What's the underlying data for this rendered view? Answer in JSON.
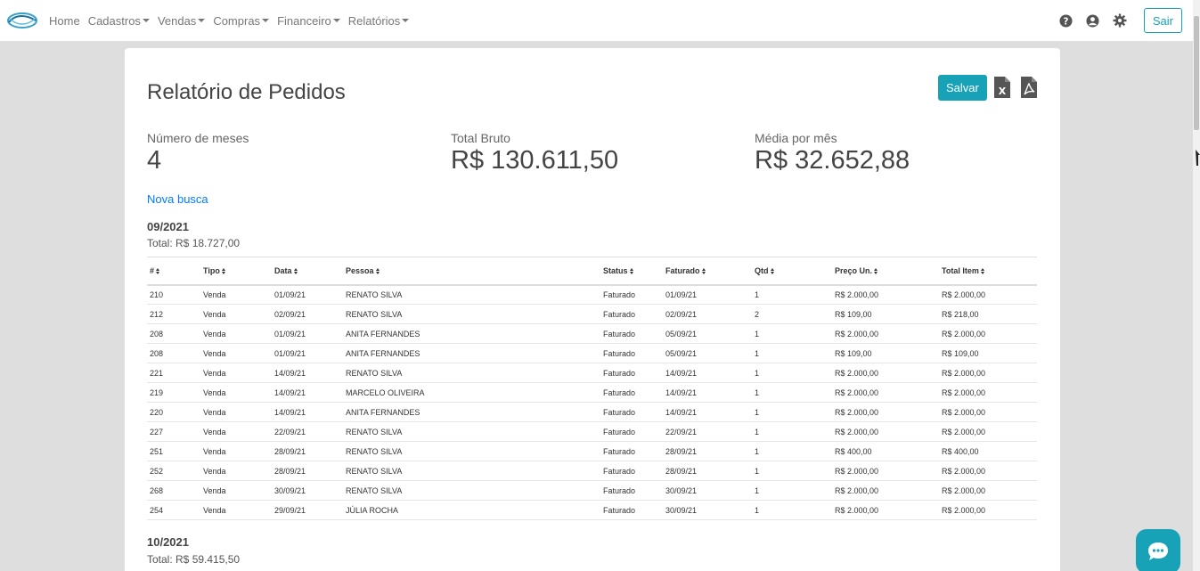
{
  "nav": {
    "items": [
      {
        "label": "Home",
        "dropdown": false
      },
      {
        "label": "Cadastros",
        "dropdown": true
      },
      {
        "label": "Vendas",
        "dropdown": true
      },
      {
        "label": "Compras",
        "dropdown": true
      },
      {
        "label": "Financeiro",
        "dropdown": true
      },
      {
        "label": "Relatórios",
        "dropdown": true
      }
    ],
    "icons": [
      "help-icon",
      "user-icon",
      "settings-icon"
    ],
    "logout_label": "Sair"
  },
  "report": {
    "title": "Relatório de Pedidos",
    "save_label": "Salvar",
    "export_icons": [
      "excel-file-icon",
      "pdf-file-icon"
    ],
    "metrics": [
      {
        "label": "Número de meses",
        "value": "4"
      },
      {
        "label": "Total Bruto",
        "value": "R$ 130.611,50"
      },
      {
        "label": "Média por mês",
        "value": "R$ 32.652,88"
      }
    ],
    "new_search_label": "Nova busca"
  },
  "columns": [
    "#",
    "Tipo",
    "Data",
    "Pessoa",
    "Status",
    "Faturado",
    "Qtd",
    "Preço Un.",
    "Total Item"
  ],
  "months": [
    {
      "title": "09/2021",
      "total": "Total: R$ 18.727,00",
      "rows": [
        [
          "210",
          "Venda",
          "01/09/21",
          "RENATO SILVA",
          "Faturado",
          "01/09/21",
          "1",
          "R$ 2.000,00",
          "R$ 2.000,00"
        ],
        [
          "212",
          "Venda",
          "02/09/21",
          "RENATO SILVA",
          "Faturado",
          "02/09/21",
          "2",
          "R$ 109,00",
          "R$ 218,00"
        ],
        [
          "208",
          "Venda",
          "01/09/21",
          "ANITA FERNANDES",
          "Faturado",
          "05/09/21",
          "1",
          "R$ 2.000,00",
          "R$ 2.000,00"
        ],
        [
          "208",
          "Venda",
          "01/09/21",
          "ANITA FERNANDES",
          "Faturado",
          "05/09/21",
          "1",
          "R$ 109,00",
          "R$ 109,00"
        ],
        [
          "221",
          "Venda",
          "14/09/21",
          "RENATO SILVA",
          "Faturado",
          "14/09/21",
          "1",
          "R$ 2.000,00",
          "R$ 2.000,00"
        ],
        [
          "219",
          "Venda",
          "14/09/21",
          "MARCELO OLIVEIRA",
          "Faturado",
          "14/09/21",
          "1",
          "R$ 2.000,00",
          "R$ 2.000,00"
        ],
        [
          "220",
          "Venda",
          "14/09/21",
          "ANITA FERNANDES",
          "Faturado",
          "14/09/21",
          "1",
          "R$ 2.000,00",
          "R$ 2.000,00"
        ],
        [
          "227",
          "Venda",
          "22/09/21",
          "RENATO SILVA",
          "Faturado",
          "22/09/21",
          "1",
          "R$ 2.000,00",
          "R$ 2.000,00"
        ],
        [
          "251",
          "Venda",
          "28/09/21",
          "RENATO SILVA",
          "Faturado",
          "28/09/21",
          "1",
          "R$ 400,00",
          "R$ 400,00"
        ],
        [
          "252",
          "Venda",
          "28/09/21",
          "RENATO SILVA",
          "Faturado",
          "28/09/21",
          "1",
          "R$ 2.000,00",
          "R$ 2.000,00"
        ],
        [
          "268",
          "Venda",
          "30/09/21",
          "RENATO SILVA",
          "Faturado",
          "30/09/21",
          "1",
          "R$ 2.000,00",
          "R$ 2.000,00"
        ],
        [
          "254",
          "Venda",
          "29/09/21",
          "JÚLIA ROCHA",
          "Faturado",
          "30/09/21",
          "1",
          "R$ 2.000,00",
          "R$ 2.000,00"
        ]
      ]
    },
    {
      "title": "10/2021",
      "total": "Total: R$ 59.415,50",
      "rows": []
    }
  ],
  "chat_icon": "chat-bubble-icon",
  "colors": {
    "accent": "#17a2b8",
    "link": "#007bff",
    "background": "#dedede"
  }
}
